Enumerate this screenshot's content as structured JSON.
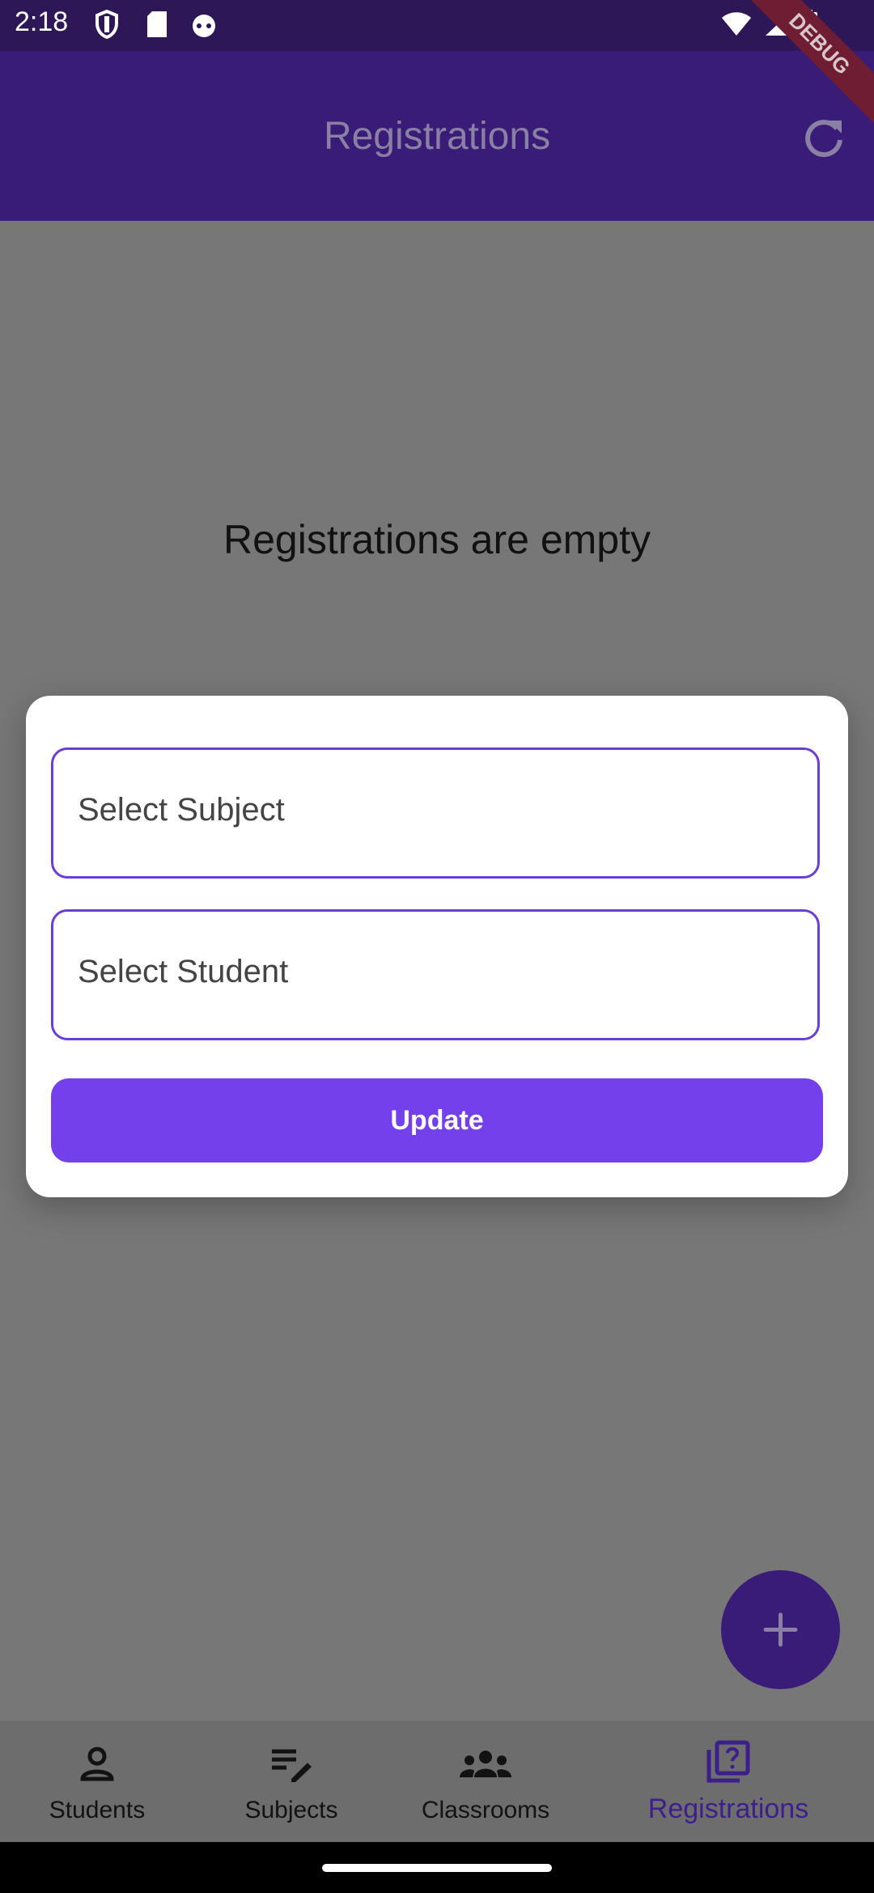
{
  "status": {
    "time": "2:18"
  },
  "app": {
    "title": "Registrations",
    "debug_banner": "DEBUG"
  },
  "content": {
    "empty_message": "Registrations are empty"
  },
  "dialog": {
    "subject_placeholder": "Select Subject",
    "student_placeholder": "Select Student",
    "update_label": "Update"
  },
  "bottom_nav": {
    "items": [
      {
        "label": "Students",
        "icon": "person-icon"
      },
      {
        "label": "Subjects",
        "icon": "edit-list-icon"
      },
      {
        "label": "Classrooms",
        "icon": "group-icon"
      },
      {
        "label": "Registrations",
        "icon": "quiz-icon",
        "active": true
      }
    ]
  },
  "colors": {
    "primary": "#7440ec",
    "appbar": "#391b78",
    "scrim": "#777777"
  }
}
